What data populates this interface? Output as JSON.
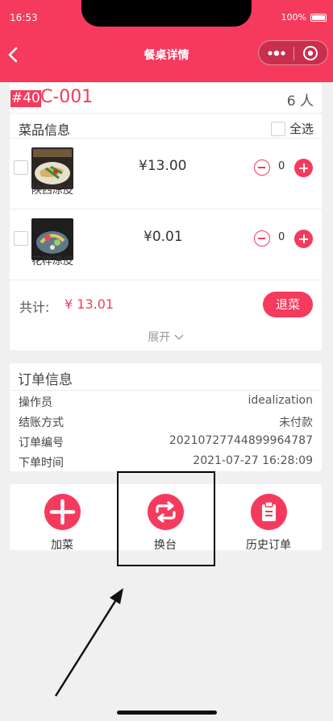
{
  "status": {
    "time": "16:53",
    "battery": "100%"
  },
  "nav": {
    "title": "餐桌详情"
  },
  "table": {
    "tag": "#40",
    "code": "C-001",
    "guests": "6 人"
  },
  "dishes": {
    "title": "菜品信息",
    "select_all": "全选",
    "items": [
      {
        "name": "陕西凉皮",
        "price": "¥13.00",
        "qty": "0"
      },
      {
        "name": "花样凉皮",
        "price": "¥0.01",
        "qty": "0"
      }
    ],
    "total_label": "共计:",
    "total_value": "¥ 13.01",
    "return_label": "退菜",
    "expand_label": "展开"
  },
  "order": {
    "title": "订单信息",
    "rows": [
      {
        "label": "操作员",
        "value": "idealization"
      },
      {
        "label": "结账方式",
        "value": "未付款"
      },
      {
        "label": "订单编号",
        "value": "20210727744899964787"
      },
      {
        "label": "下单时间",
        "value": "2021-07-27 16:28:09"
      }
    ]
  },
  "actions": [
    {
      "label": "加菜",
      "icon": "plus-icon"
    },
    {
      "label": "换台",
      "icon": "swap-icon"
    },
    {
      "label": "历史订单",
      "icon": "clipboard-icon"
    }
  ],
  "colors": {
    "accent": "#f53a5d",
    "background": "#f0f0f0"
  }
}
